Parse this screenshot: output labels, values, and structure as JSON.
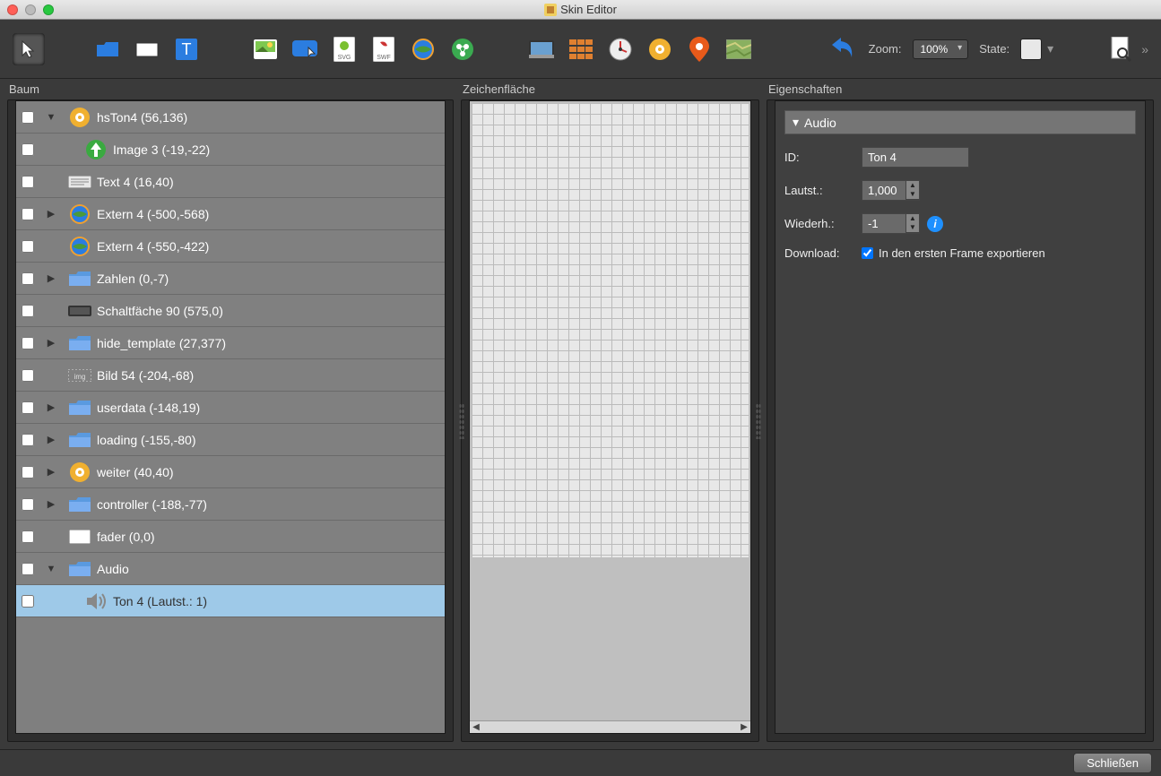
{
  "window": {
    "title": "Skin Editor"
  },
  "toolbar": {
    "zoom_label": "Zoom:",
    "zoom_value": "100%",
    "state_label": "State:",
    "overflow": "»"
  },
  "panels": {
    "tree_label": "Baum",
    "canvas_label": "Zeichenfläche",
    "props_label": "Eigenschaften"
  },
  "tree": [
    {
      "icon": "hotspot",
      "label": "hsTon4 (56,136)",
      "indent": 0,
      "expander": "down",
      "expanded": true
    },
    {
      "icon": "image-green",
      "label": "Image 3 (-19,-22)",
      "indent": 1,
      "expander": "none"
    },
    {
      "icon": "text",
      "label": "Text 4 (16,40)",
      "indent": 0,
      "expander": "none"
    },
    {
      "icon": "globe",
      "label": "Extern 4 (-500,-568)",
      "indent": 0,
      "expander": "right"
    },
    {
      "icon": "globe",
      "label": "Extern 4 (-550,-422)",
      "indent": 0,
      "expander": "none"
    },
    {
      "icon": "folder",
      "label": "Zahlen (0,-7)",
      "indent": 0,
      "expander": "right"
    },
    {
      "icon": "button",
      "label": "Schaltfäche 90 (575,0)",
      "indent": 0,
      "expander": "none"
    },
    {
      "icon": "folder",
      "label": "hide_template (27,377)",
      "indent": 0,
      "expander": "right"
    },
    {
      "icon": "image-wf",
      "label": "Bild 54 (-204,-68)",
      "indent": 0,
      "expander": "none"
    },
    {
      "icon": "folder",
      "label": "userdata (-148,19)",
      "indent": 0,
      "expander": "right"
    },
    {
      "icon": "folder",
      "label": "loading (-155,-80)",
      "indent": 0,
      "expander": "right"
    },
    {
      "icon": "hotspot",
      "label": "weiter (40,40)",
      "indent": 0,
      "expander": "right"
    },
    {
      "icon": "folder",
      "label": "controller (-188,-77)",
      "indent": 0,
      "expander": "right"
    },
    {
      "icon": "rect",
      "label": "fader (0,0)",
      "indent": 0,
      "expander": "none"
    },
    {
      "icon": "folder",
      "label": "Audio",
      "indent": 0,
      "expander": "down",
      "expanded": true
    },
    {
      "icon": "speaker",
      "label": "Ton 4 (Lautst.: 1)",
      "indent": 1,
      "expander": "none",
      "selected": true
    }
  ],
  "properties": {
    "section_title": "Audio",
    "id_label": "ID:",
    "id_value": "Ton 4",
    "volume_label": "Lautst.:",
    "volume_value": "1,000",
    "repeat_label": "Wiederh.:",
    "repeat_value": "-1",
    "download_label": "Download:",
    "download_checkbox_label": "In den ersten Frame exportieren",
    "download_checked": true
  },
  "footer": {
    "close_label": "Schließen"
  }
}
